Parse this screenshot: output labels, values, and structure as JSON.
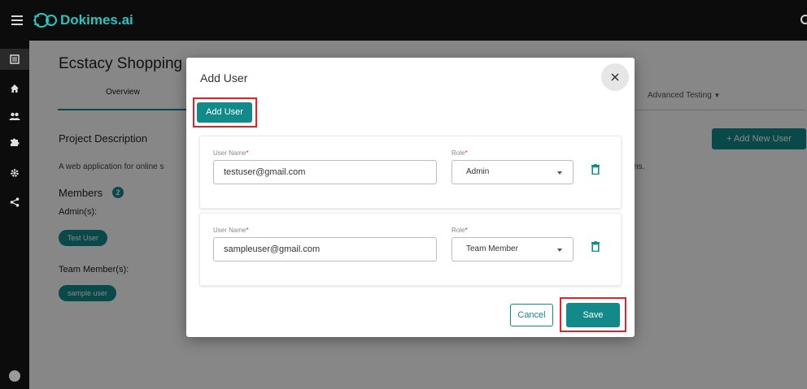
{
  "app": {
    "name": "Dokimes.ai"
  },
  "colors": {
    "accent": "#138a8a",
    "highlight": "#d9262c",
    "topbar": "#0c0c0c",
    "logo": "#2bc4c0"
  },
  "sidebar": {
    "items": [
      {
        "icon": "list-icon",
        "active": true
      },
      {
        "icon": "home-icon",
        "active": false
      },
      {
        "icon": "users-icon",
        "active": false
      },
      {
        "icon": "puzzle-icon",
        "active": false
      },
      {
        "icon": "gear-icon",
        "active": false
      },
      {
        "icon": "share-icon",
        "active": false
      }
    ]
  },
  "page": {
    "title": "Ecstacy Shopping",
    "tabs": {
      "overview": "Overview",
      "advanced": "Advanced Testing"
    },
    "project_description_title": "Project Description",
    "description": "A web application for online s",
    "description_tail": "ns.",
    "members_label": "Members",
    "members_count": "2",
    "admins_label": "Admin(s):",
    "admin_chip": "Test User",
    "team_label": "Team Member(s):",
    "team_chip": "sample user",
    "add_new_user_label": "+ Add New User"
  },
  "modal": {
    "title": "Add User",
    "add_user_label": "Add User",
    "username_label": "User Name",
    "role_label": "Role",
    "required_mark": "*",
    "users": [
      {
        "username": "testuser@gmail.com",
        "role": "Admin"
      },
      {
        "username": "sampleuser@gmail.com",
        "role": "Team Member"
      }
    ],
    "cancel_label": "Cancel",
    "save_label": "Save"
  }
}
